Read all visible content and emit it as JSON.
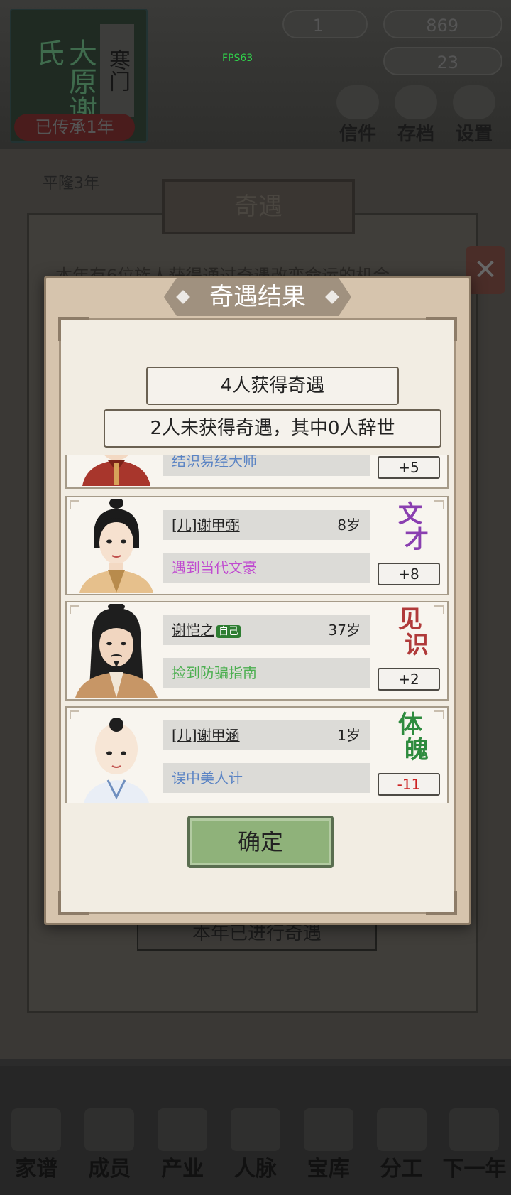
{
  "background": {
    "family_book": {
      "title": "大原谢氏",
      "side_label": "寒门",
      "badge": "已传承1年"
    },
    "resources": {
      "coins": "1",
      "gems": "869",
      "gold": "23"
    },
    "fps": "FPS63",
    "top_icons": [
      {
        "label": "信件",
        "icon": "letter-icon"
      },
      {
        "label": "存档",
        "icon": "save-icon"
      },
      {
        "label": "设置",
        "icon": "settings-icon"
      }
    ],
    "year_label": "平隆3年",
    "event_panel_title": "奇遇",
    "event_panel_text": "本年有6位族人获得通过奇遇改变命运的机会",
    "year_done_label": "本年已进行奇遇",
    "nav": [
      {
        "label": "家谱",
        "icon": "family-tree-icon"
      },
      {
        "label": "成员",
        "icon": "members-icon"
      },
      {
        "label": "产业",
        "icon": "industry-icon"
      },
      {
        "label": "人脉",
        "icon": "network-icon"
      },
      {
        "label": "宝库",
        "icon": "treasury-icon"
      },
      {
        "label": "分工",
        "icon": "division-icon"
      },
      {
        "label": "下一年",
        "icon": "next-year-icon"
      }
    ]
  },
  "dialog": {
    "title": "奇遇结果",
    "summary_gained": "4人获得奇遇",
    "summary_missed": "2人未获得奇遇，其中0人辞世",
    "confirm_label": "确定",
    "results": [
      {
        "name": "",
        "age": "",
        "event": "结识易经大师",
        "event_color": "#5b84c4",
        "attr": [
          "",
          ""
        ],
        "attr_color": "#555555",
        "delta": "+5",
        "delta_color": "#222222",
        "self": false,
        "avatar": "male-red-robe"
      },
      {
        "name": "[儿]谢甲弼",
        "age": "8岁",
        "event": "遇到当代文豪",
        "event_color": "#c04bd0",
        "attr": [
          "文",
          "才"
        ],
        "attr_color": "#8a3fb0",
        "delta": "+8",
        "delta_color": "#222222",
        "self": false,
        "avatar": "boy-topknot"
      },
      {
        "name": "谢恺之",
        "age": "37岁",
        "event": "捡到防骗指南",
        "event_color": "#4caf50",
        "attr": [
          "见",
          "识"
        ],
        "attr_color": "#b03a3a",
        "delta": "+2",
        "delta_color": "#222222",
        "self": true,
        "self_tag": "自己",
        "avatar": "man-long-hair"
      },
      {
        "name": "[儿]谢甲涵",
        "age": "1岁",
        "event": "误中美人计",
        "event_color": "#5b84c4",
        "attr": [
          "体",
          "魄"
        ],
        "attr_color": "#2e8b3e",
        "delta": "-11",
        "delta_color": "#cc2222",
        "self": false,
        "avatar": "baby"
      }
    ]
  }
}
